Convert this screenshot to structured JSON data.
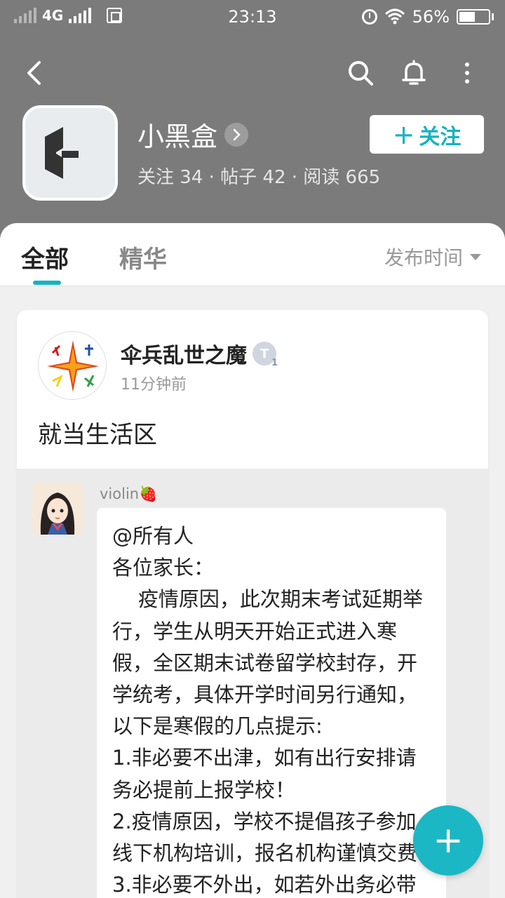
{
  "status_bar": {
    "network": "4G",
    "time": "23:13",
    "battery": "56%",
    "battery_level": 0.56
  },
  "nav": {
    "back_icon": "back-arrow-icon",
    "search_icon": "search-icon",
    "notification_icon": "bell-icon",
    "more_icon": "more-vertical-icon"
  },
  "community": {
    "name": "小黑盒",
    "stats": "关注 34 · 帖子 42 · 阅读 665",
    "follow_label": "关注",
    "accent_color": "#15b3c0"
  },
  "tabs": {
    "items": [
      {
        "label": "全部",
        "active": true
      },
      {
        "label": "精华",
        "active": false
      }
    ],
    "sort_label": "发布时间"
  },
  "post": {
    "author": "伞兵乱世之魔",
    "level_badge": "T",
    "level_number": "1",
    "time": "11分钟前",
    "text": "就当生活区",
    "shared": {
      "name": "violin🍓",
      "message": "@所有人\n各位家长：\n    疫情原因，此次期末考试延期举行，学生从明天开始正式进入寒假，全区期末试卷留学校封存，开学统考，具体开学时间另行通知，以下是寒假的几点提示:\n1.非必要不出津，如有出行安排请务必提前上报学校！\n2.疫情原因，学校不提倡孩子参加线下机构培训，报名机构谨慎交费\n3.非必要不外出，如若外出务必带"
    }
  },
  "fab": {
    "label": "+"
  }
}
